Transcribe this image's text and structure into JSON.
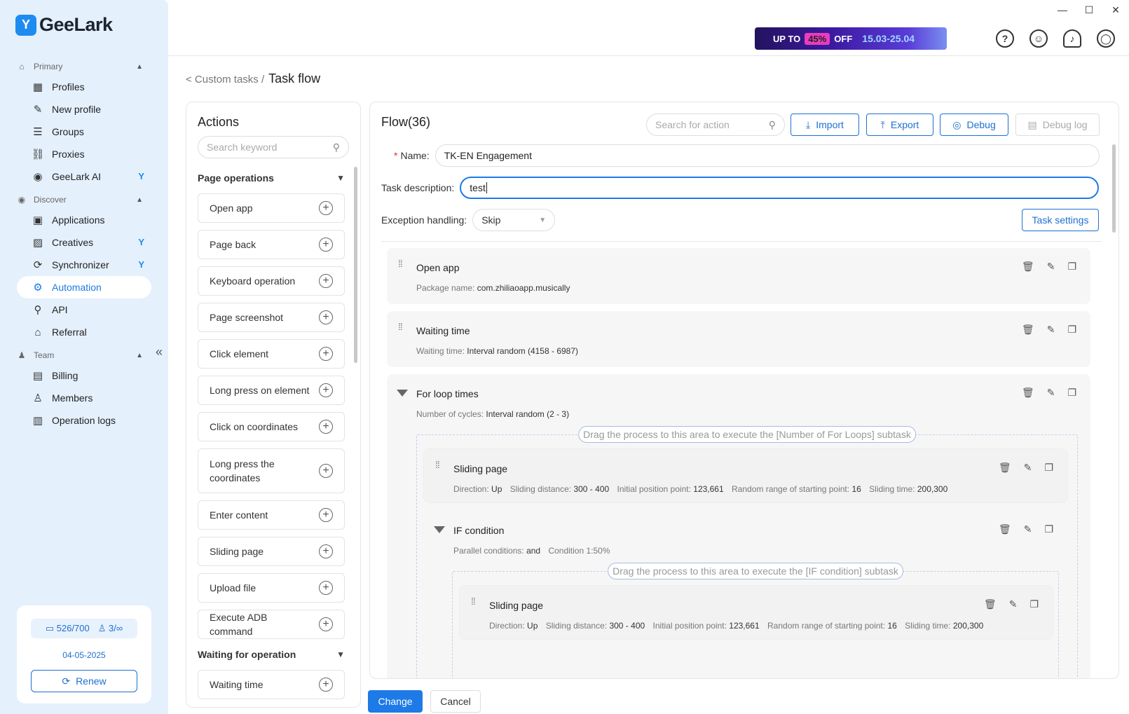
{
  "window": {
    "minimize": "—",
    "maximize": "☐",
    "close": "✕"
  },
  "brand": {
    "name": "GeeLark",
    "mark": "Y"
  },
  "sidebar": {
    "sections": [
      {
        "label": "Primary",
        "icon": "home-icon"
      },
      {
        "label": "Discover",
        "icon": "eye-icon"
      },
      {
        "label": "Team",
        "icon": "team-icon"
      }
    ],
    "primary": [
      {
        "label": "Profiles",
        "icon": "▦"
      },
      {
        "label": "New profile",
        "icon": "✎"
      },
      {
        "label": "Groups",
        "icon": "☰"
      },
      {
        "label": "Proxies",
        "icon": "⛓"
      },
      {
        "label": "GeeLark AI",
        "icon": "◉",
        "badge": "Y"
      }
    ],
    "discover": [
      {
        "label": "Applications",
        "icon": "▣"
      },
      {
        "label": "Creatives",
        "icon": "▨",
        "badge": "Y"
      },
      {
        "label": "Synchronizer",
        "icon": "⟳",
        "badge": "Y"
      },
      {
        "label": "Automation",
        "icon": "⚙"
      },
      {
        "label": "API",
        "icon": "⚲"
      },
      {
        "label": "Referral",
        "icon": "⌂"
      }
    ],
    "team": [
      {
        "label": "Billing",
        "icon": "▤"
      },
      {
        "label": "Members",
        "icon": "♙"
      },
      {
        "label": "Operation logs",
        "icon": "▥"
      }
    ],
    "collapse": "«",
    "plan": {
      "profiles": "526/700",
      "members": "3/∞",
      "date": "04-05-2025",
      "renew": "Renew"
    }
  },
  "promo": {
    "upto": "UP TO",
    "pct": "45%",
    "off": "OFF",
    "dates": "15.03-25.04"
  },
  "topicons": {
    "help": "?",
    "support": "☺",
    "bell": "♪",
    "user": "◯"
  },
  "breadcrumb": {
    "back": "< Custom tasks /",
    "current": "Task flow"
  },
  "actions": {
    "title": "Actions",
    "search_placeholder": "Search keyword",
    "groups": [
      {
        "title": "Page operations",
        "items": [
          "Open app",
          "Page back",
          "Keyboard operation",
          "Page screenshot",
          "Click element",
          "Long press on element",
          "Click on coordinates",
          "Long press the coordinates",
          "Enter content",
          "Sliding page",
          "Upload file",
          "Execute ADB command"
        ]
      },
      {
        "title": "Waiting for operation",
        "items": [
          "Waiting time"
        ]
      }
    ]
  },
  "flow": {
    "title": "Flow(36)",
    "search_placeholder": "Search for action",
    "import": "Import",
    "export": "Export",
    "debug": "Debug",
    "debug_log": "Debug log",
    "name_label": "Name:",
    "name_value": "TK-EN Engagement",
    "desc_label": "Task description:",
    "desc_value": "test",
    "exception_label": "Exception handling:",
    "exception_value": "Skip",
    "task_settings": "Task settings",
    "steps": {
      "open_app": {
        "name": "Open app",
        "k1": "Package name:",
        "v1": "com.zhiliaoapp.musically"
      },
      "waiting": {
        "name": "Waiting time",
        "k1": "Waiting time:",
        "v1": "Interval random (4158 - 6987)"
      },
      "for_loop": {
        "name": "For loop times",
        "k1": "Number of cycles:",
        "v1": "Interval random (2 - 3)",
        "hint": "Drag the process to this area to execute the [Number of For Loops] subtask"
      },
      "slide1": {
        "name": "Sliding page",
        "k1": "Direction:",
        "v1": "Up",
        "k2": "Sliding distance:",
        "v2": "300 - 400",
        "k3": "Initial position point:",
        "v3": "123,661",
        "k4": "Random range of starting point:",
        "v4": "16",
        "k5": "Sliding time:",
        "v5": "200,300"
      },
      "if_cond": {
        "name": "IF condition",
        "k1": "Parallel conditions:",
        "v1": "and",
        "k2": "Condition 1:50%",
        "hint": "Drag the process to this area to execute the [IF condition] subtask"
      },
      "slide2": {
        "name": "Sliding page",
        "k1": "Direction:",
        "v1": "Up",
        "k2": "Sliding distance:",
        "v2": "300 - 400",
        "k3": "Initial position point:",
        "v3": "123,661",
        "k4": "Random range of starting point:",
        "v4": "16",
        "k5": "Sliding time:",
        "v5": "200,300"
      }
    }
  },
  "footer": {
    "change": "Change",
    "cancel": "Cancel"
  }
}
